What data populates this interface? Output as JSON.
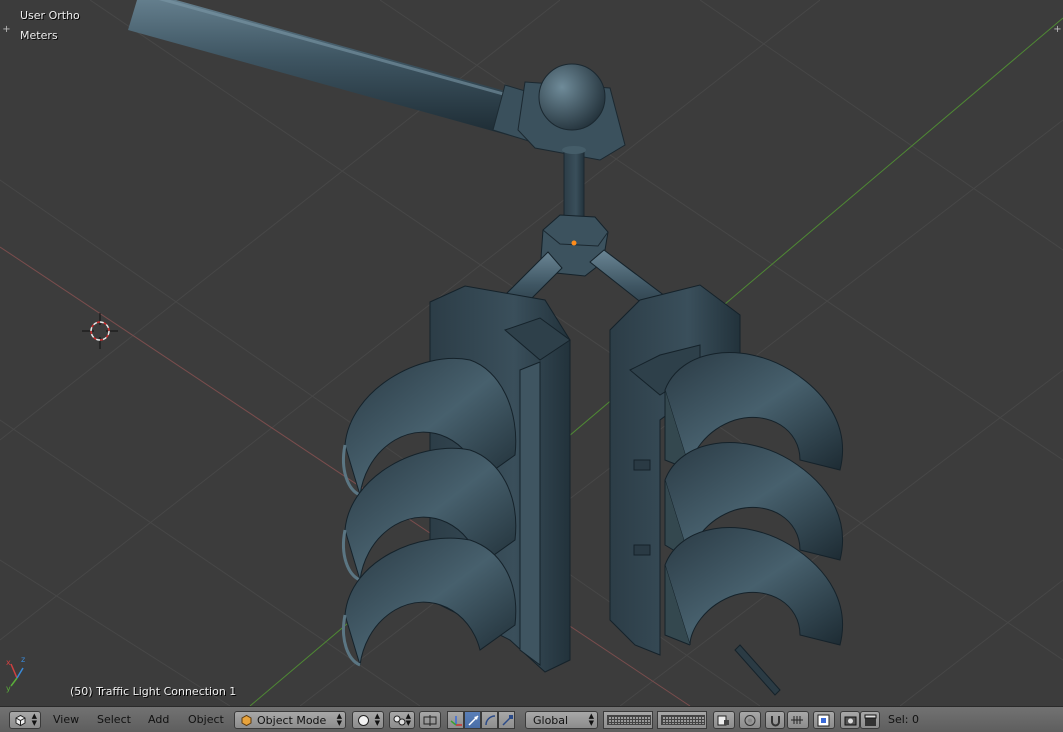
{
  "viewport": {
    "view_name": "User Ortho",
    "units": "Meters",
    "object_info": "(50) Traffic Light Connection 1"
  },
  "toolbar": {
    "editor_type_icon": "cube-icon",
    "menus": [
      "View",
      "Select",
      "Add",
      "Object"
    ],
    "mode": "Object Mode",
    "shading_icon": "solid-sphere-icon",
    "pivot_icon": "pivot-median-icon",
    "manipulator_icons": [
      "manipulator-toggle-icon",
      "translate-icon",
      "rotate-icon",
      "scale-icon"
    ],
    "orientation": "Global",
    "layers_icon": "layer-grid-icon",
    "lock_icon": "lock-layer-icon",
    "proportional_icon": "proportional-edit-icon",
    "snap_icon": "magnet-icon",
    "snap_target_icon": "snap-target-icon",
    "render_icons": [
      "render-still-icon",
      "render-animation-icon"
    ],
    "sel_label": "Sel: 0"
  },
  "colors": {
    "viewport_bg": "#3c3c3c",
    "grid_line": "#464646",
    "x_axis": "#c86b6b",
    "y_axis": "#5ea03c",
    "model_metal": "#3f5663",
    "header_bg": "#6a6a6a",
    "active_blue": "#5680c2"
  }
}
